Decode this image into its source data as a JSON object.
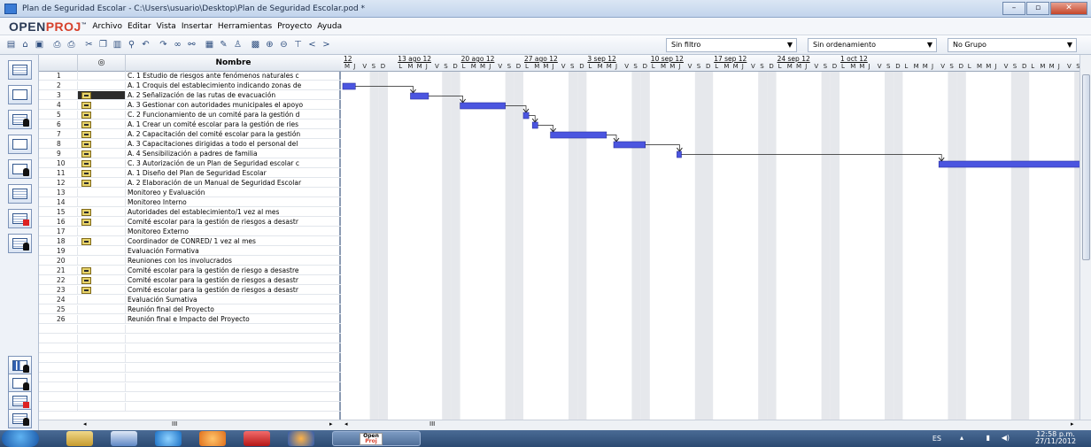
{
  "window": {
    "title": "Plan de Seguridad Escolar - C:\\Users\\usuario\\Desktop\\Plan de Seguridad Escolar.pod *"
  },
  "app": {
    "logo_main": "OPEN",
    "logo_accent": "PROJ",
    "logo_tm": "™"
  },
  "menu": [
    "Archivo",
    "Editar",
    "Vista",
    "Insertar",
    "Herramientas",
    "Proyecto",
    "Ayuda"
  ],
  "toolbar": {
    "filter": "Sin filtro",
    "sort": "Sin ordenamiento",
    "group": "No Grupo"
  },
  "grid": {
    "indicator_header": "◎",
    "name_header": "Nombre",
    "rows": [
      {
        "id": "1",
        "name": "C. 1 Estudio de riesgos ante fenómenos naturales c",
        "note": false
      },
      {
        "id": "2",
        "name": "A. 1 Croquis del establecimiento indicando zonas de",
        "note": false
      },
      {
        "id": "3",
        "name": "A. 2 Señalización de las rutas de evacuación",
        "note": true
      },
      {
        "id": "4",
        "name": "A. 3 Gestionar con autoridades municipales el apoyo",
        "note": true
      },
      {
        "id": "5",
        "name": "C. 2 Funcionamiento de un comité para la gestión d",
        "note": true
      },
      {
        "id": "6",
        "name": "A. 1 Crear un comité escolar para la gestión de ries",
        "note": true
      },
      {
        "id": "7",
        "name": "A. 2 Capacitación del comité escolar para la gestión",
        "note": true
      },
      {
        "id": "8",
        "name": "A. 3 Capacitaciones dirigidas a todo el personal del",
        "note": true
      },
      {
        "id": "9",
        "name": "A. 4 Sensibilización a padres de familia",
        "note": true
      },
      {
        "id": "10",
        "name": "C. 3 Autorización de un Plan de Seguridad escolar c",
        "note": true
      },
      {
        "id": "11",
        "name": "A. 1 Diseño del Plan de Seguridad Escolar",
        "note": true
      },
      {
        "id": "12",
        "name": "A. 2 Elaboración de un Manual de Seguridad Escolar",
        "note": true
      },
      {
        "id": "13",
        "name": "Monitoreo y Evaluación",
        "note": false
      },
      {
        "id": "14",
        "name": "Monitoreo Interno",
        "note": false
      },
      {
        "id": "15",
        "name": "Autoridades del establecimiento/1 vez al mes",
        "note": true
      },
      {
        "id": "16",
        "name": "Comité escolar para la gestión de riesgos a desastr",
        "note": true
      },
      {
        "id": "17",
        "name": "Monitoreo Externo",
        "note": false
      },
      {
        "id": "18",
        "name": "Coordinador de CONRED/ 1 vez al mes",
        "note": true
      },
      {
        "id": "19",
        "name": "Evaluación Formativa",
        "note": false
      },
      {
        "id": "20",
        "name": "Reuniones con los involucrados",
        "note": false
      },
      {
        "id": "21",
        "name": "Comité escolar para la gestión de riesgo a desastre",
        "note": true
      },
      {
        "id": "22",
        "name": "Comité escolar para la gestión de riesgos a desastr",
        "note": true
      },
      {
        "id": "23",
        "name": "Comité escolar para la gestión de riesgos a desastr",
        "note": true
      },
      {
        "id": "24",
        "name": "Evaluación Sumativa",
        "note": false
      },
      {
        "id": "25",
        "name": "Reunión final del Proyecto",
        "note": false
      },
      {
        "id": "26",
        "name": "Reunión final e Impacto del Proyecto",
        "note": false
      }
    ],
    "scroll_mid": "III"
  },
  "gantt": {
    "weeks": [
      "12",
      "13 ago 12",
      "20 ago 12",
      "27 ago 12",
      "3 sep 12",
      "10 sep 12",
      "17 sep 12",
      "24 sep 12",
      "1 oct 12"
    ],
    "day_letters": [
      "L",
      "M",
      "M",
      "J",
      "V",
      "S",
      "D"
    ],
    "first_days": [
      "M",
      "J",
      "V",
      "S",
      "D"
    ],
    "bar_color": "#4b55e0",
    "scroll_mid": "III"
  },
  "taskbar": {
    "openproj_line1": "Open",
    "openproj_line2": "Proj",
    "lang": "ES",
    "time": "12:58 p.m.",
    "date": "27/11/2012"
  }
}
